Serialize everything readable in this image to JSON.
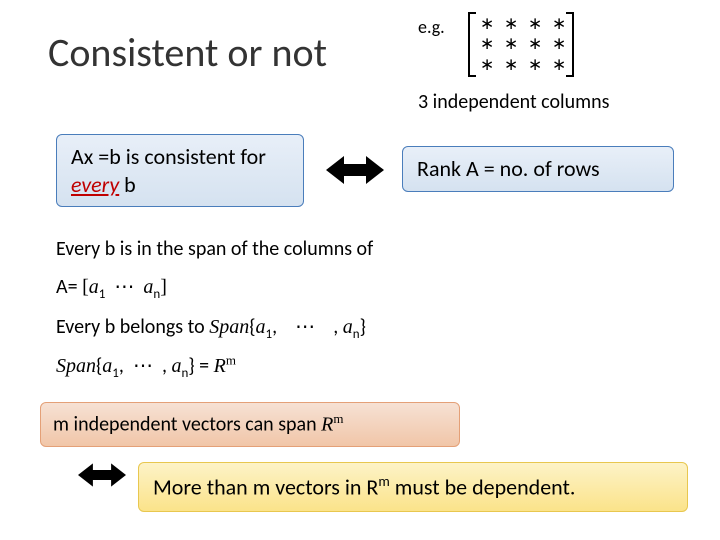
{
  "title": "Consistent or not",
  "eg": "e.g.",
  "caption": "3 independent columns",
  "boxA": {
    "pre": "Ax =b is consistent for ",
    "every": "every",
    "post": " b"
  },
  "boxB": "Rank A = no. of rows",
  "lines": {
    "l1": "Every b is in the span of the columns of",
    "l2_pre": "A= ",
    "l3_pre": "Every b belongs to ",
    "span_lbl": "Span",
    "a1": "a",
    "sub1": "1",
    "dots": "⋯",
    "an": "a",
    "subn": "n",
    "eq": " = ",
    "R": "R",
    "m": "m"
  },
  "boxC": {
    "pre": "m independent vectors can span ",
    "R": "R",
    "m": "m"
  },
  "boxD": {
    "pre": "More than m vectors in R",
    "m": "m",
    "post": " must be dependent."
  },
  "matrix": {
    "cell": "∗"
  }
}
